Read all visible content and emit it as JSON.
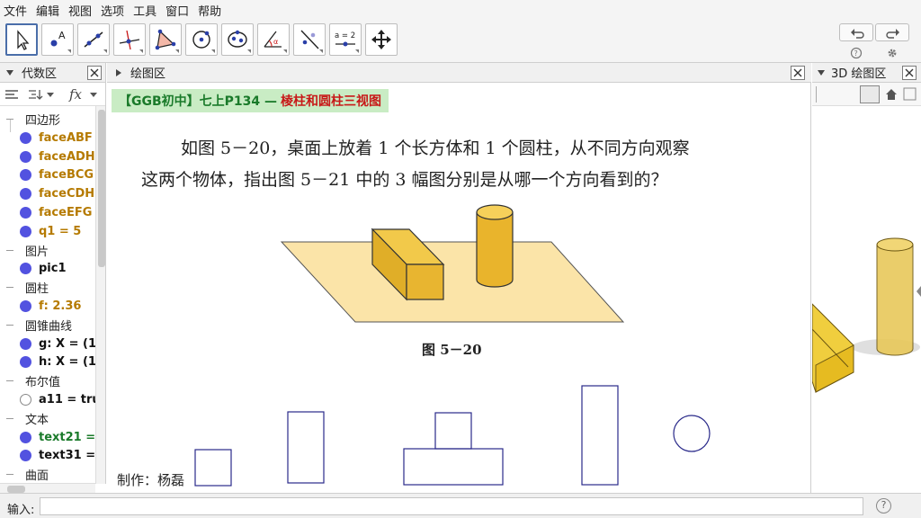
{
  "menu": [
    "文件",
    "编辑",
    "视图",
    "选项",
    "工具",
    "窗口",
    "帮助"
  ],
  "toolbar": {
    "tools": [
      "move-tool-icon",
      "point-tool-icon",
      "line-tool-icon",
      "perpendicular-tool-icon",
      "polygon-tool-icon",
      "circle-tool-icon",
      "conic-tool-icon",
      "angle-tool-icon",
      "reflect-tool-icon",
      "slider-tool-icon",
      "move-view-tool-icon"
    ],
    "slider_label": "a = 2"
  },
  "algebra_panel": {
    "title": "代数区",
    "rows": [
      {
        "kind": "group",
        "text": "四边形"
      },
      {
        "kind": "item",
        "text": "faceABF",
        "color": "#b57a00"
      },
      {
        "kind": "item",
        "text": "faceADH",
        "color": "#b57a00"
      },
      {
        "kind": "item",
        "text": "faceBCG",
        "color": "#b57a00"
      },
      {
        "kind": "item",
        "text": "faceCDH",
        "color": "#b57a00"
      },
      {
        "kind": "item",
        "text": "faceEFG",
        "color": "#b57a00"
      },
      {
        "kind": "item",
        "text": "q1 = 5",
        "color": "#b57a00"
      },
      {
        "kind": "group",
        "text": "图片"
      },
      {
        "kind": "item",
        "text": "pic1",
        "color": "#111111"
      },
      {
        "kind": "group",
        "text": "圆柱"
      },
      {
        "kind": "item",
        "text": "f: 2.36",
        "color": "#b57a00"
      },
      {
        "kind": "group",
        "text": "圆锥曲线"
      },
      {
        "kind": "item",
        "text": "g: X = (1,",
        "color": "#111111"
      },
      {
        "kind": "item",
        "text": "h: X = (1,",
        "color": "#111111"
      },
      {
        "kind": "group",
        "text": "布尔值"
      },
      {
        "kind": "item-empty",
        "text": "a11 = tru",
        "color": "#111111"
      },
      {
        "kind": "group",
        "text": "文本"
      },
      {
        "kind": "item",
        "text": "text21 =",
        "color": "#1a7a2a"
      },
      {
        "kind": "item",
        "text": "text31 =",
        "color": "#111111"
      },
      {
        "kind": "group",
        "text": "曲面"
      }
    ]
  },
  "graphics_panel": {
    "title": "绘图区",
    "banner_green": "【GGB初中】七上P134 —",
    "banner_red": "棱柱和圆柱三视图",
    "paragraph_line1": "如图 5－20，桌面上放着 1 个长方体和 1 个圆柱，从不同方向观察",
    "paragraph_line2": "这两个物体，指出图 5－21 中的 3 幅图分别是从哪一个方向看到的？",
    "figure_caption": "图 5－20",
    "author": "制作：杨磊"
  },
  "panel_3d": {
    "title": "3D 绘图区"
  },
  "input_bar": {
    "label": "输入:",
    "value": ""
  },
  "colors": {
    "table": "#fbe4a8",
    "solid": "#e3b52a",
    "view_stroke": "#2a2a8a",
    "object_dot": "#5252e0"
  }
}
